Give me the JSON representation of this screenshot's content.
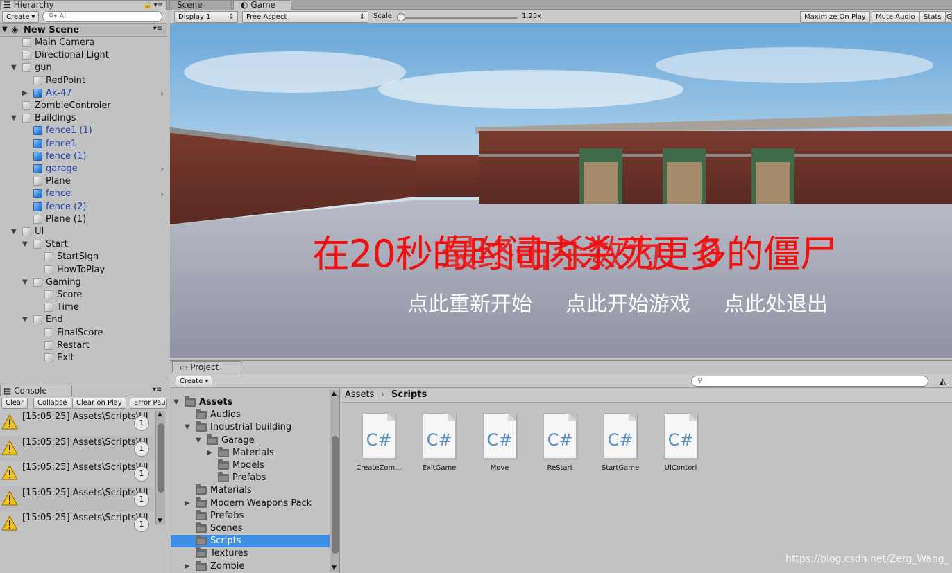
{
  "hierarchy": {
    "tab": "Hierarchy",
    "create": "Create",
    "search_placeholder": "All",
    "scene": "New Scene",
    "items": [
      {
        "label": "Main Camera",
        "depth": 0,
        "blue": false
      },
      {
        "label": "Directional Light",
        "depth": 0,
        "blue": false
      },
      {
        "label": "gun",
        "depth": 0,
        "blue": false,
        "expand": "down"
      },
      {
        "label": "RedPoint",
        "depth": 1,
        "blue": false
      },
      {
        "label": "Ak-47",
        "depth": 1,
        "blue": true,
        "expand": "right",
        "more": true
      },
      {
        "label": "ZombieControler",
        "depth": 0,
        "blue": false
      },
      {
        "label": "Buildings",
        "depth": 0,
        "blue": false,
        "expand": "down"
      },
      {
        "label": "fence1 (1)",
        "depth": 1,
        "blue": true
      },
      {
        "label": "fence1",
        "depth": 1,
        "blue": true
      },
      {
        "label": "fence (1)",
        "depth": 1,
        "blue": true
      },
      {
        "label": "garage",
        "depth": 1,
        "blue": true,
        "more": true
      },
      {
        "label": "Plane",
        "depth": 1,
        "blue": false
      },
      {
        "label": "fence",
        "depth": 1,
        "blue": true,
        "more": true
      },
      {
        "label": "fence (2)",
        "depth": 1,
        "blue": true
      },
      {
        "label": "Plane (1)",
        "depth": 1,
        "blue": false
      },
      {
        "label": "UI",
        "depth": 0,
        "blue": false,
        "expand": "down"
      },
      {
        "label": "Start",
        "depth": 1,
        "blue": false,
        "expand": "down"
      },
      {
        "label": "StartSign",
        "depth": 2,
        "blue": false
      },
      {
        "label": "HowToPlay",
        "depth": 2,
        "blue": false
      },
      {
        "label": "Gaming",
        "depth": 1,
        "blue": false,
        "expand": "down"
      },
      {
        "label": "Score",
        "depth": 2,
        "blue": false
      },
      {
        "label": "Time",
        "depth": 2,
        "blue": false
      },
      {
        "label": "End",
        "depth": 1,
        "blue": false,
        "expand": "down"
      },
      {
        "label": "FinalScore",
        "depth": 2,
        "blue": false
      },
      {
        "label": "Restart",
        "depth": 2,
        "blue": false
      },
      {
        "label": "Exit",
        "depth": 2,
        "blue": false
      }
    ]
  },
  "tabs": {
    "scene": "Scene",
    "game": "Game"
  },
  "game_toolbar": {
    "display": "Display 1",
    "aspect": "Free Aspect",
    "scale_label": "Scale",
    "scale_value": "1.25x",
    "maximize": "Maximize On Play",
    "mute": "Mute Audio",
    "stats": "Stats",
    "gizmos": "G"
  },
  "game_view": {
    "overlap_text_a": "在20秒的时间内杀死更多的僵尸",
    "overlap_text_b": "最终击杀数为：0",
    "buttons": [
      "点此重新开始",
      "点此开始游戏",
      "点此处退出"
    ]
  },
  "console": {
    "tab": "Console",
    "buttons": [
      "Clear",
      "Collapse",
      "Clear on Play",
      "Error Pau"
    ],
    "messages": [
      {
        "text": "[15:05:25] Assets\\Scripts\\UI",
        "count": "1"
      },
      {
        "text": "[15:05:25] Assets\\Scripts\\UI",
        "count": "1"
      },
      {
        "text": "[15:05:25] Assets\\Scripts\\UI",
        "count": "1"
      },
      {
        "text": "[15:05:25] Assets\\Scripts\\UI",
        "count": "1"
      },
      {
        "text": "[15:05:25] Assets\\Scripts\\UI",
        "count": "1"
      }
    ]
  },
  "project": {
    "tab": "Project",
    "create": "Create",
    "breadcrumb": [
      "Assets",
      "Scripts"
    ],
    "tree": [
      {
        "label": "Assets",
        "depth": 0,
        "bold": true,
        "expand": "down"
      },
      {
        "label": "Audios",
        "depth": 1
      },
      {
        "label": "Industrial building",
        "depth": 1,
        "expand": "down"
      },
      {
        "label": "Garage",
        "depth": 2,
        "expand": "down"
      },
      {
        "label": "Materials",
        "depth": 3,
        "expand": "right"
      },
      {
        "label": "Models",
        "depth": 3
      },
      {
        "label": "Prefabs",
        "depth": 3
      },
      {
        "label": "Materials",
        "depth": 1
      },
      {
        "label": "Modern Weapons Pack",
        "depth": 1,
        "expand": "right"
      },
      {
        "label": "Prefabs",
        "depth": 1
      },
      {
        "label": "Scenes",
        "depth": 1
      },
      {
        "label": "Scripts",
        "depth": 1,
        "selected": true
      },
      {
        "label": "Textures",
        "depth": 1
      },
      {
        "label": "Zombie",
        "depth": 1,
        "expand": "right"
      }
    ],
    "files": [
      {
        "glyph": "C#",
        "name": "CreateZom..."
      },
      {
        "glyph": "C#",
        "name": "ExitGame"
      },
      {
        "glyph": "C#",
        "name": "Move"
      },
      {
        "glyph": "C#",
        "name": "ReStart"
      },
      {
        "glyph": "C#",
        "name": "StartGame"
      },
      {
        "glyph": "C#",
        "name": "UIContorl"
      }
    ]
  },
  "watermark": "https://blog.csdn.net/Zerg_Wang_",
  "colors": {
    "overlay_red": "#f01010",
    "selection": "#3d8ee6",
    "prefab_blue": "#1f3fa8"
  }
}
